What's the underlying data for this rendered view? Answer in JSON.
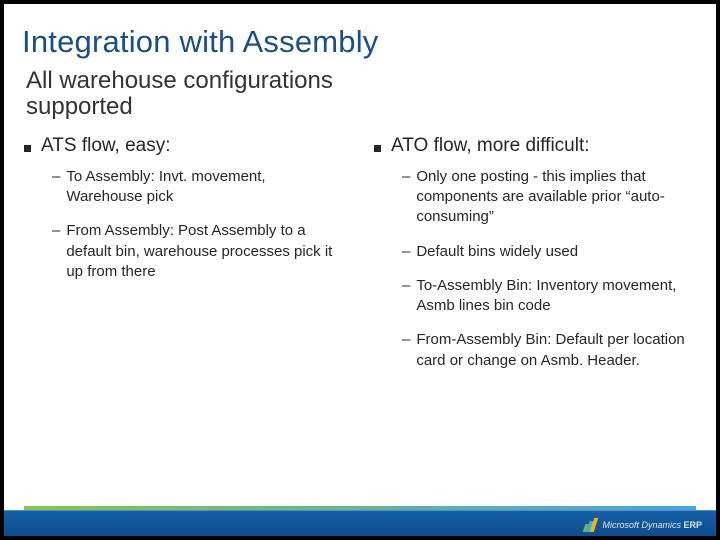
{
  "title": "Integration with Assembly",
  "subtitle": "All warehouse configurations supported",
  "left": {
    "heading": "ATS flow, easy:",
    "items": [
      "To Assembly: Invt. movement, Warehouse pick",
      "From Assembly: Post Assembly to a default bin, warehouse processes pick it up from there"
    ]
  },
  "right": {
    "heading": "ATO flow, more difficult:",
    "items": [
      "Only one posting - this implies that components are available prior “auto-consuming”",
      "Default bins widely used",
      "To-Assembly Bin: Inventory movement, Asmb lines bin code",
      "From-Assembly Bin: Default per location card or change on Asmb. Header."
    ]
  },
  "brand": {
    "name": "Microsoft Dynamics",
    "suffix": "ERP"
  }
}
